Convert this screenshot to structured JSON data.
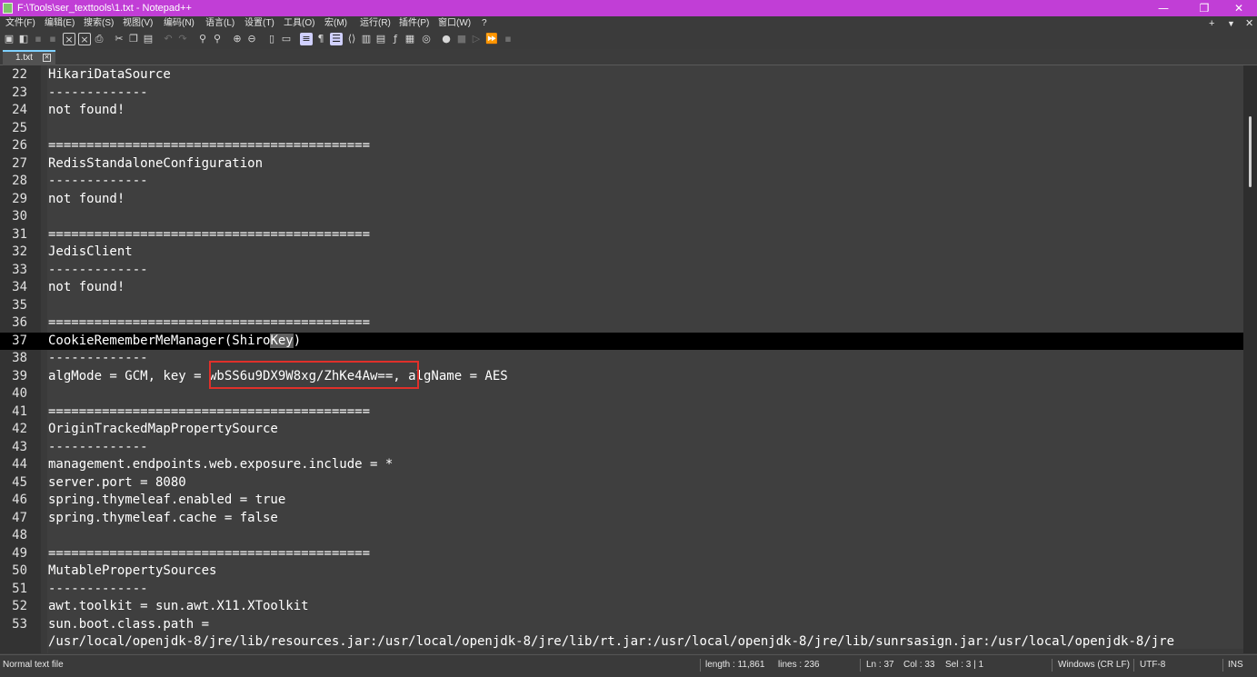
{
  "window": {
    "title": "F:\\Tools\\ser_texttools\\1.txt - Notepad++",
    "minimize": "—",
    "maximize": "❐",
    "close": "✕"
  },
  "menu": {
    "items": [
      "文件(F)",
      "编辑(E)",
      "搜索(S)",
      "视图(V)",
      "编码(N)",
      "语言(L)",
      "设置(T)",
      "工具(O)",
      "宏(M)",
      "运行(R)",
      "插件(P)",
      "窗口(W)",
      "?"
    ],
    "right": [
      "+",
      "▼",
      "✕"
    ]
  },
  "toolbar": {
    "icons": [
      "new-file-icon",
      "open-file-icon",
      "save-icon",
      "save-all-icon",
      "close-icon",
      "close-all-icon",
      "print-icon",
      "cut-icon",
      "copy-icon",
      "paste-icon",
      "undo-icon",
      "redo-icon",
      "find-icon",
      "replace-icon",
      "zoom-in-icon",
      "zoom-out-icon",
      "sync-vertical-icon",
      "sync-horizontal-icon",
      "word-wrap-icon",
      "show-all-chars-icon",
      "indent-guide-icon",
      "xml-tag-icon",
      "document-map-icon",
      "document-list-icon",
      "function-list-icon",
      "folder-workspace-icon",
      "monitoring-icon",
      "record-macro-icon",
      "stop-record-icon",
      "play-macro-icon",
      "run-macro-multiple-icon",
      "save-macro-icon"
    ]
  },
  "tabs": [
    {
      "label": "1.txt",
      "close": "✕"
    }
  ],
  "editor": {
    "lines": [
      {
        "n": "22",
        "t": "HikariDataSource"
      },
      {
        "n": "23",
        "t": "-------------"
      },
      {
        "n": "24",
        "t": "not found!"
      },
      {
        "n": "25",
        "t": ""
      },
      {
        "n": "26",
        "t": "=========================================="
      },
      {
        "n": "27",
        "t": "RedisStandaloneConfiguration"
      },
      {
        "n": "28",
        "t": "-------------"
      },
      {
        "n": "29",
        "t": "not found!"
      },
      {
        "n": "30",
        "t": ""
      },
      {
        "n": "31",
        "t": "=========================================="
      },
      {
        "n": "32",
        "t": "JedisClient"
      },
      {
        "n": "33",
        "t": "-------------"
      },
      {
        "n": "34",
        "t": "not found!"
      },
      {
        "n": "35",
        "t": ""
      },
      {
        "n": "36",
        "t": "=========================================="
      },
      {
        "n": "37",
        "t_before": "CookieRememberMeManager(Shiro",
        "t_sel": "Key",
        "t_after": ")",
        "current": true
      },
      {
        "n": "38",
        "t": "-------------"
      },
      {
        "n": "39",
        "t": "algMode = GCM, key = wbSS6u9DX9W8xg/ZhKe4Aw==, algName = AES"
      },
      {
        "n": "40",
        "t": ""
      },
      {
        "n": "41",
        "t": "=========================================="
      },
      {
        "n": "42",
        "t": "OriginTrackedMapPropertySource"
      },
      {
        "n": "43",
        "t": "-------------"
      },
      {
        "n": "44",
        "t": "management.endpoints.web.exposure.include = *"
      },
      {
        "n": "45",
        "t": "server.port = 8080"
      },
      {
        "n": "46",
        "t": "spring.thymeleaf.enabled = true"
      },
      {
        "n": "47",
        "t": "spring.thymeleaf.cache = false"
      },
      {
        "n": "48",
        "t": ""
      },
      {
        "n": "49",
        "t": "=========================================="
      },
      {
        "n": "50",
        "t": "MutablePropertySources"
      },
      {
        "n": "51",
        "t": "-------------"
      },
      {
        "n": "52",
        "t": "awt.toolkit = sun.awt.X11.XToolkit"
      },
      {
        "n": "53",
        "t": "sun.boot.class.path ="
      },
      {
        "n": "",
        "t": "/usr/local/openjdk-8/jre/lib/resources.jar:/usr/local/openjdk-8/jre/lib/rt.jar:/usr/local/openjdk-8/jre/lib/sunrsasign.jar:/usr/local/openjdk-8/jre"
      }
    ]
  },
  "status": {
    "file_type": "Normal text file",
    "length": "length : 11,861",
    "lines": "lines : 236",
    "ln": "Ln : 37",
    "col": "Col : 33",
    "sel": "Sel : 3 | 1",
    "eol": "Windows (CR LF)",
    "encoding": "UTF-8",
    "mode": "INS"
  },
  "colors": {
    "title_bar": "#c13ed6",
    "editor_bg": "#3f3f3f",
    "highlight_box": "#e0302a"
  }
}
